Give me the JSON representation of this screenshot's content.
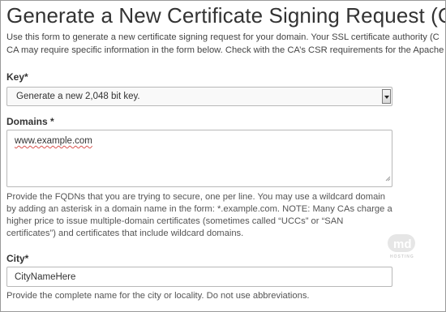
{
  "page": {
    "title": "Generate a New Certificate Signing Request (CSR)",
    "intro_line1": "Use this form to generate a new certificate signing request for your domain. Your SSL certificate authority (C",
    "intro_line2": "CA may require specific information in the form below. Check with the CA’s CSR requirements for the Apache"
  },
  "form": {
    "key": {
      "label": "Key*",
      "selected": "Generate a new 2,048 bit key."
    },
    "domains": {
      "label": "Domains *",
      "value": "www.example.com",
      "help_line1": "Provide the FQDNs that you are trying to secure, one per line. You may use a wildcard domain",
      "help_line2": "by adding an asterisk in a domain name in the form: *.example.com. NOTE: Many CAs charge a",
      "help_line3": "higher price to issue multiple-domain certificates (sometimes called “UCCs” or “SAN",
      "help_line4": "certificates”) and certificates that include wildcard domains."
    },
    "city": {
      "label": "City*",
      "value": "CityNameHere",
      "help": "Provide the complete name for the city or locality. Do not use abbreviations."
    }
  },
  "watermark": {
    "logo_text": "md",
    "sub_text": "HOSTING"
  },
  "icons": {
    "select_arrow": "chevron-down-icon",
    "resize_grip": "resize-grip-icon"
  }
}
